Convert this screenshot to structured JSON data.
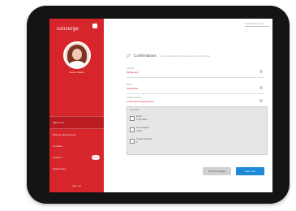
{
  "app": {
    "logo_text": "concerge"
  },
  "user": {
    "name": "Louise Cassin"
  },
  "sidebar": {
    "items": [
      {
        "label": "Take a run",
        "active": true
      },
      {
        "label": "Book an appointment"
      },
      {
        "label": "Contacts"
      },
      {
        "label": "Check-in",
        "has_toggle": true
      },
      {
        "label": "Preferences"
      }
    ],
    "bottom_text": "Sign out"
  },
  "topbar": {
    "link": "Help and support"
  },
  "main": {
    "title": "Confirmations",
    "hint": "Set your default notifications and confirmations",
    "fields": [
      {
        "label": "Channel",
        "value": "Mobile app"
      },
      {
        "label": "Status",
        "value": "Scheduled"
      },
      {
        "label": "Default reminder",
        "value": "1 day before appointment"
      }
    ],
    "panel": {
      "title": "Reminders",
      "options": [
        {
          "label": "Email",
          "sub": "1 day before"
        },
        {
          "label": "Text message",
          "sub": "1 hour"
        },
        {
          "label": "In-app notification",
          "sub": "0"
        }
      ]
    },
    "buttons": {
      "cancel": "Cancel changes",
      "save": "Save rule"
    }
  },
  "colors": {
    "brand": "#d6252b",
    "primary_button": "#1e8ad6"
  }
}
